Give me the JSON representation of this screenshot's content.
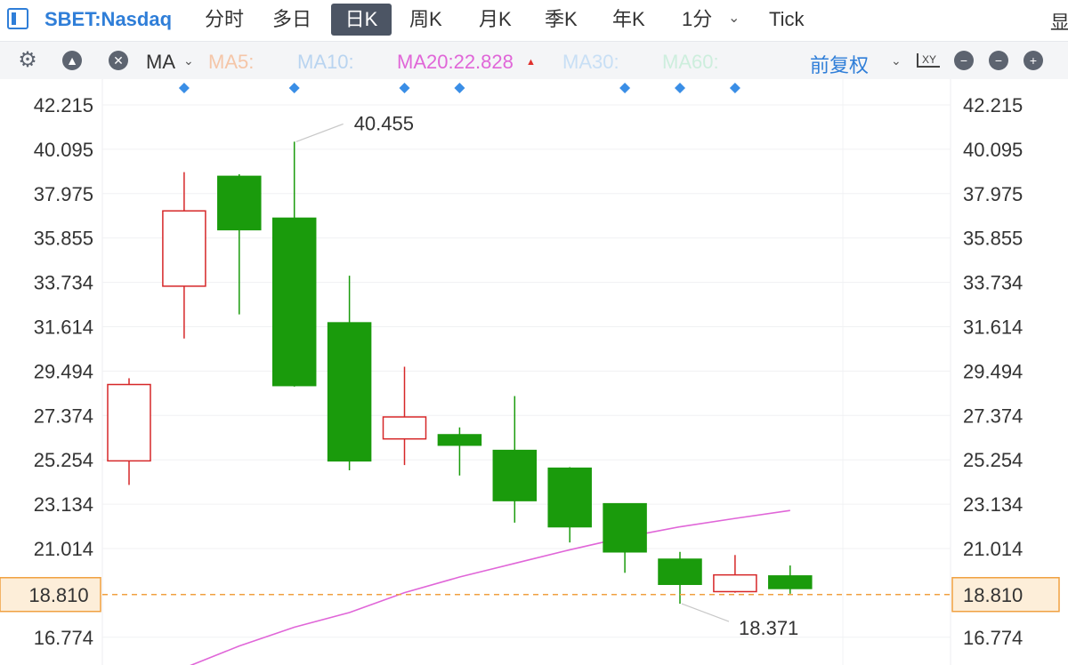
{
  "header": {
    "symbol": "SBET:Nasdaq",
    "tabs": [
      "分时",
      "多日",
      "日K",
      "周K",
      "月K",
      "季K",
      "年K",
      "1分",
      "Tick"
    ],
    "active_tab": "日K",
    "right_edge_text": "显"
  },
  "toolbar": {
    "indicator": "MA",
    "ma_items": [
      {
        "label": "MA5:",
        "color": "#f5c6a8"
      },
      {
        "label": "MA10:",
        "color": "#b9d4f0"
      },
      {
        "label": "MA20:22.828",
        "color": "#e066d8"
      },
      {
        "label": "MA30:",
        "color": "#c8dff5"
      },
      {
        "label": "MA60:",
        "color": "#cdeedd"
      }
    ],
    "adjust_label": "前复权",
    "icons": [
      "gear-icon",
      "triangle-up-icon",
      "close-icon",
      "chevron-down-icon",
      "xy-axis-icon",
      "minus-icon",
      "minus-icon",
      "plus-icon"
    ]
  },
  "colors": {
    "up": "#d62728",
    "down": "#1a9b0c",
    "ma20": "#e066d8",
    "price_line": "#f0a040",
    "marker": "#3a8ee6",
    "accent": "#2f7ed8"
  },
  "chart_data": {
    "type": "candlestick",
    "y_ticks": [
      "42.215",
      "40.095",
      "37.975",
      "35.855",
      "33.734",
      "31.614",
      "29.494",
      "27.374",
      "25.254",
      "23.134",
      "21.014",
      "18.810",
      "16.774"
    ],
    "ylim": [
      15.6,
      43.35
    ],
    "current_price": 18.81,
    "current_price_label": "18.810",
    "candles": [
      {
        "open": 25.2,
        "high": 29.15,
        "low": 24.05,
        "close": 28.85,
        "dir": "up"
      },
      {
        "open": 33.55,
        "high": 39.0,
        "low": 31.05,
        "close": 37.15,
        "dir": "up"
      },
      {
        "open": 38.8,
        "high": 38.9,
        "low": 32.2,
        "close": 36.25,
        "dir": "down"
      },
      {
        "open": 36.8,
        "high": 40.455,
        "low": 28.75,
        "close": 28.8,
        "dir": "down"
      },
      {
        "open": 31.8,
        "high": 34.05,
        "low": 24.75,
        "close": 25.2,
        "dir": "down"
      },
      {
        "open": 26.25,
        "high": 29.7,
        "low": 25.0,
        "close": 27.3,
        "dir": "up"
      },
      {
        "open": 26.45,
        "high": 26.8,
        "low": 24.5,
        "close": 25.95,
        "dir": "down"
      },
      {
        "open": 25.7,
        "high": 28.3,
        "low": 22.25,
        "close": 23.3,
        "dir": "down"
      },
      {
        "open": 24.85,
        "high": 24.9,
        "low": 21.3,
        "close": 22.05,
        "dir": "down"
      },
      {
        "open": 23.15,
        "high": 23.1,
        "low": 19.85,
        "close": 20.85,
        "dir": "down"
      },
      {
        "open": 20.5,
        "high": 20.85,
        "low": 18.371,
        "close": 19.3,
        "dir": "down"
      },
      {
        "open": 18.95,
        "high": 20.7,
        "low": 18.9,
        "close": 19.75,
        "dir": "up"
      },
      {
        "open": 19.7,
        "high": 20.2,
        "low": 18.85,
        "close": 19.1,
        "dir": "down"
      }
    ],
    "ma20": {
      "name": "MA20",
      "start_index": 1,
      "values": [
        15.3,
        16.35,
        17.25,
        17.95,
        18.9,
        19.65,
        20.3,
        20.95,
        21.55,
        22.05,
        22.45,
        22.828
      ]
    },
    "markers_at_index": [
      1,
      3,
      5,
      6,
      9,
      10,
      11
    ],
    "annotations": [
      {
        "label": "40.455",
        "index": 3,
        "value": 40.455,
        "side": "high"
      },
      {
        "label": "18.371",
        "index": 10,
        "value": 18.371,
        "side": "low"
      }
    ]
  }
}
